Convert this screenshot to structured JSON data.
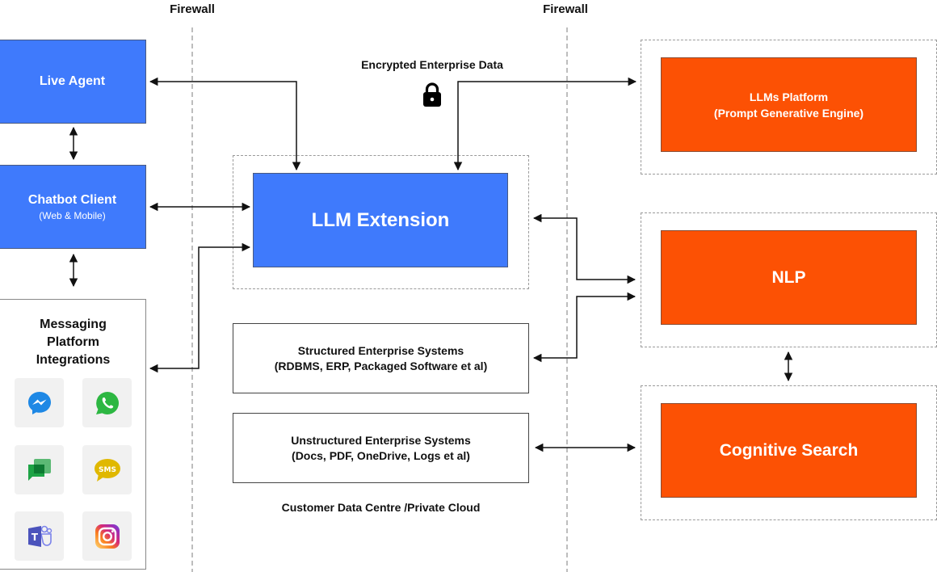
{
  "firewalls": [
    {
      "label": "Firewall"
    },
    {
      "label": "Firewall"
    }
  ],
  "left_column": {
    "live_agent": {
      "title": "Live Agent"
    },
    "chatbot_client": {
      "title": "Chatbot Client",
      "subtitle": "(Web & Mobile)"
    },
    "messaging": {
      "title_lines": [
        "Messaging",
        "Platform",
        "Integrations"
      ],
      "channels": [
        {
          "name": "Messenger",
          "icon": "messenger-icon",
          "color": "#1e88e5"
        },
        {
          "name": "WhatsApp",
          "icon": "whatsapp-icon",
          "color": "#2db742"
        },
        {
          "name": "Google Chat",
          "icon": "google-chat-icon",
          "color": "#1ea446"
        },
        {
          "name": "SMS",
          "icon": "sms-icon",
          "color": "#e0b800",
          "badge_text": "SMS"
        },
        {
          "name": "Microsoft Teams",
          "icon": "teams-icon",
          "color": "#4b53bc",
          "badge_text": "T"
        },
        {
          "name": "Instagram",
          "icon": "instagram-icon",
          "color": "#d62976"
        }
      ]
    }
  },
  "center": {
    "encrypted_label": "Encrypted Enterprise Data",
    "lock_icon": "lock-icon",
    "llm_extension": {
      "title": "LLM Extension"
    },
    "structured": {
      "title": "Structured Enterprise Systems",
      "subtitle": "(RDBMS, ERP, Packaged Software et al)"
    },
    "unstructured": {
      "title": "Unstructured Enterprise Systems",
      "subtitle": "(Docs, PDF, OneDrive, Logs et al)"
    },
    "zone_label": "Customer Data Centre /Private Cloud"
  },
  "right_column": {
    "llms_platform": {
      "title": "LLMs Platform",
      "subtitle": "(Prompt Generative Engine)"
    },
    "nlp": {
      "title": "NLP"
    },
    "cognitive_search": {
      "title": "Cognitive Search"
    }
  },
  "colors": {
    "blue": "#3f7afc",
    "orange": "#fc5104",
    "connector": "#111111",
    "dashed_border": "#9a9a9a"
  },
  "connections": [
    {
      "from": "LLM Extension",
      "to": "Live Agent",
      "direction": "bidirectional"
    },
    {
      "from": "Live Agent",
      "to": "Chatbot Client",
      "direction": "bidirectional"
    },
    {
      "from": "Chatbot Client",
      "to": "Messaging Platform Integrations",
      "direction": "bidirectional"
    },
    {
      "from": "Chatbot Client",
      "to": "LLM Extension",
      "direction": "bidirectional"
    },
    {
      "from": "Messaging Platform Integrations",
      "to": "LLM Extension",
      "direction": "bidirectional"
    },
    {
      "from": "LLM Extension",
      "to": "LLMs Platform",
      "direction": "bidirectional",
      "label": "Encrypted Enterprise Data"
    },
    {
      "from": "LLM Extension",
      "to": "NLP",
      "direction": "bidirectional"
    },
    {
      "from": "Structured Enterprise Systems",
      "to": "NLP",
      "direction": "bidirectional"
    },
    {
      "from": "NLP",
      "to": "Cognitive Search",
      "direction": "bidirectional"
    },
    {
      "from": "Unstructured Enterprise Systems",
      "to": "Cognitive Search",
      "direction": "bidirectional"
    }
  ]
}
